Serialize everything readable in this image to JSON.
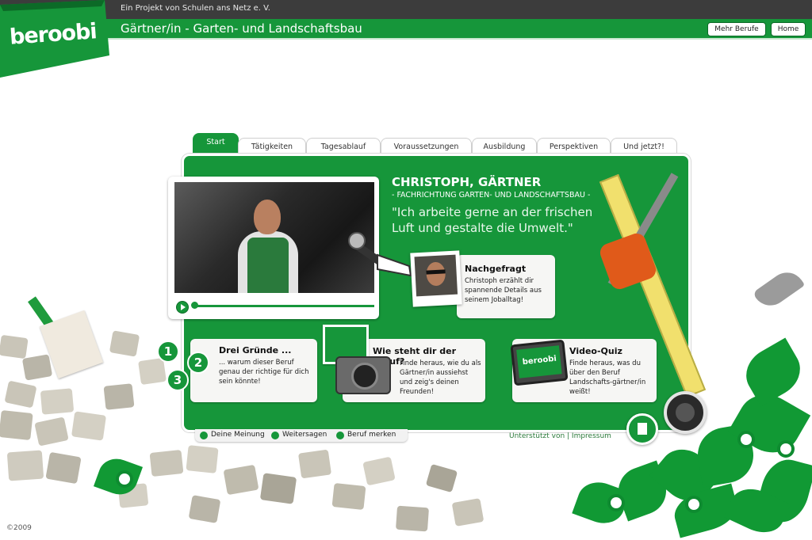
{
  "header": {
    "project": "Ein Projekt von Schulen ans Netz e. V.",
    "title": "Gärtner/in - Garten- und Landschaftsbau",
    "logo": "beroobi",
    "buttons": [
      "Mehr Berufe",
      "Home"
    ]
  },
  "tabs": [
    {
      "label": "Start",
      "active": true
    },
    {
      "label": "Tätigkeiten",
      "active": false
    },
    {
      "label": "Tagesablauf",
      "active": false
    },
    {
      "label": "Voraussetzungen",
      "active": false
    },
    {
      "label": "Ausbildung",
      "active": false
    },
    {
      "label": "Perspektiven",
      "active": false
    },
    {
      "label": "Und jetzt?!",
      "active": false
    }
  ],
  "hero": {
    "name": "CHRISTOPH, GÄRTNER",
    "subtitle": "- FACHRICHTUNG GARTEN- UND LANDSCHAFTSBAU -",
    "quote": "\"Ich arbeite gerne an der frischen Luft und gestalte die Umwelt.\""
  },
  "nachgefragt": {
    "title": "Nachgefragt",
    "text": "Christoph erzählt dir spannende Details aus seinem Joballtag!"
  },
  "cards": {
    "reasons": {
      "title": "Drei Gründe ...",
      "text": "... warum dieser Beruf genau der richtige für dich sein könnte!",
      "numbers": [
        "1",
        "2",
        "3"
      ]
    },
    "photo": {
      "title": "Wie steht dir der Beruf?",
      "text": "Finde heraus, wie du als Gärtner/in aussiehst und zeig's deinen Freunden!"
    },
    "quiz": {
      "title": "Video-Quiz",
      "text": "Finde heraus, was du über den Beruf Landschafts-gärtner/in weißt!",
      "tv_logo": "beroobi"
    }
  },
  "bottom_links": [
    "Deine Meinung",
    "Weitersagen",
    "Beruf merken"
  ],
  "footer": {
    "support": "Unterstützt von | Impressum",
    "copyright": "2009"
  },
  "colors": {
    "brand_green": "#16963a",
    "dark_bar": "#3c3c3c"
  },
  "icons": [
    "play-icon",
    "speaker-icon",
    "notes-icon",
    "camera-icon",
    "tv-icon",
    "microphone-icon"
  ]
}
